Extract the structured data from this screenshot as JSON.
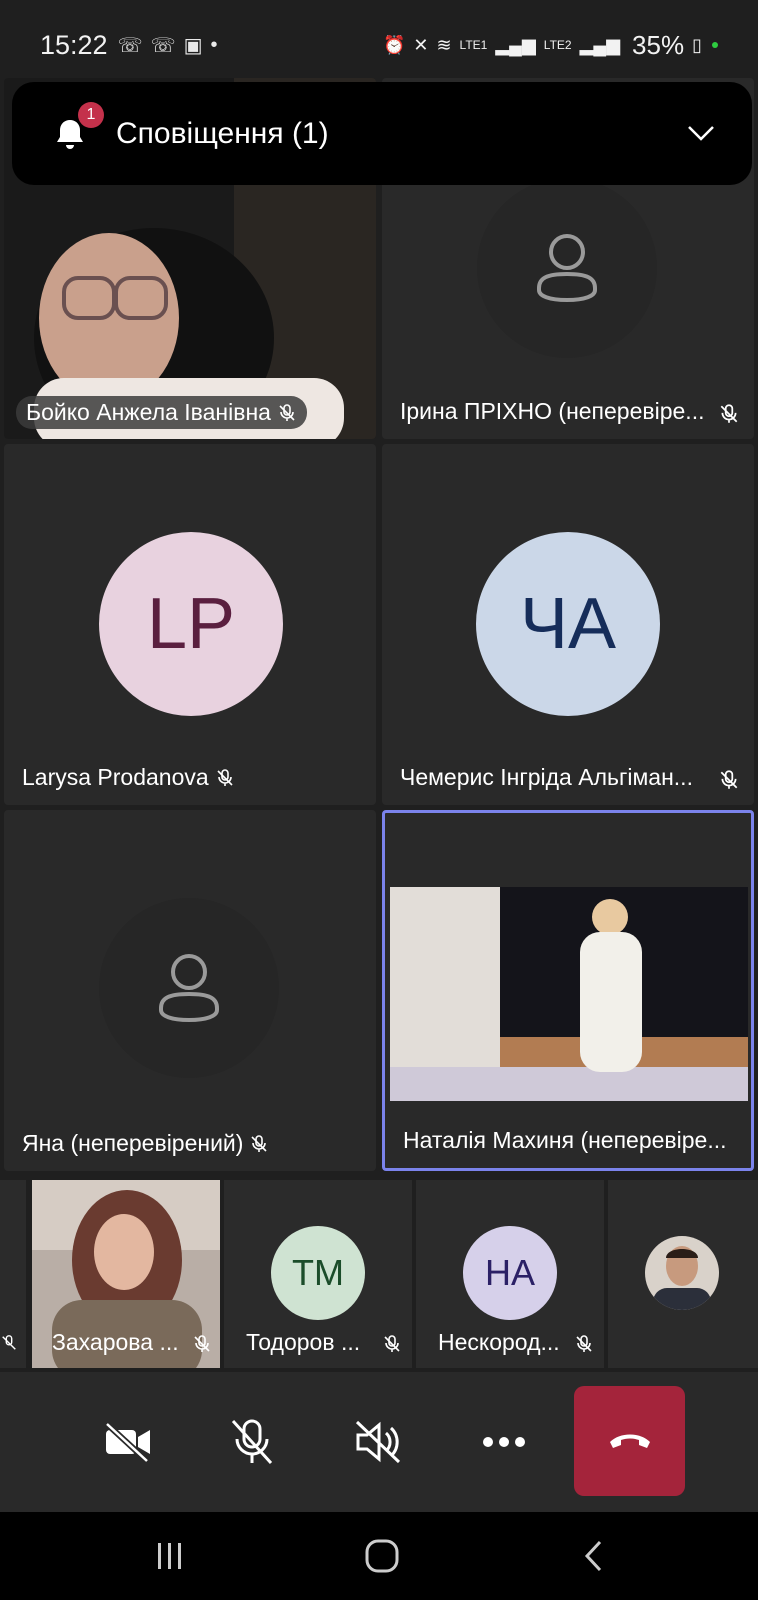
{
  "status_bar": {
    "time": "15:22",
    "battery": "35%",
    "network1": "LTE1",
    "network2": "LTE2"
  },
  "notification": {
    "title": "Сповіщення (1)",
    "badge": "1"
  },
  "participants": [
    {
      "name": "Бойко Анжела Іванівна",
      "video": true
    },
    {
      "name": "Ірина ПРІХНО (неперевіре...",
      "video": false
    },
    {
      "name": "Larysa Prodanova",
      "initials": "LP",
      "avatar_bg": "#e8d2df",
      "avatar_fg": "#5a1f3f"
    },
    {
      "name": "Чемерис Інгріда Альгіман...",
      "initials": "ЧА",
      "avatar_bg": "#cbd7e8",
      "avatar_fg": "#162d5a"
    },
    {
      "name": "Яна (неперевірений)",
      "video": false
    },
    {
      "name": "Наталія Махиня (неперевіре...",
      "video": true,
      "active_speaker": true
    }
  ],
  "strip": [
    {
      "name": "Захарова ...",
      "video": true
    },
    {
      "name": "Тодоров ...",
      "initials": "ТМ",
      "avatar_bg": "#cfe3d2",
      "avatar_fg": "#1b4d2a"
    },
    {
      "name": "Нескород...",
      "initials": "НА",
      "avatar_bg": "#d6d0ea",
      "avatar_fg": "#2b2066"
    },
    {
      "name": "",
      "photo": true
    }
  ],
  "controls": {
    "camera": "camera-off-icon",
    "mic": "mic-off-icon",
    "speaker": "speaker-off-icon",
    "more": "more-icon",
    "hangup": "hangup-icon",
    "hangup_color": "#a4243b"
  },
  "colors": {
    "active_border": "#7b83eb",
    "mute_badge": "#c4314b"
  }
}
